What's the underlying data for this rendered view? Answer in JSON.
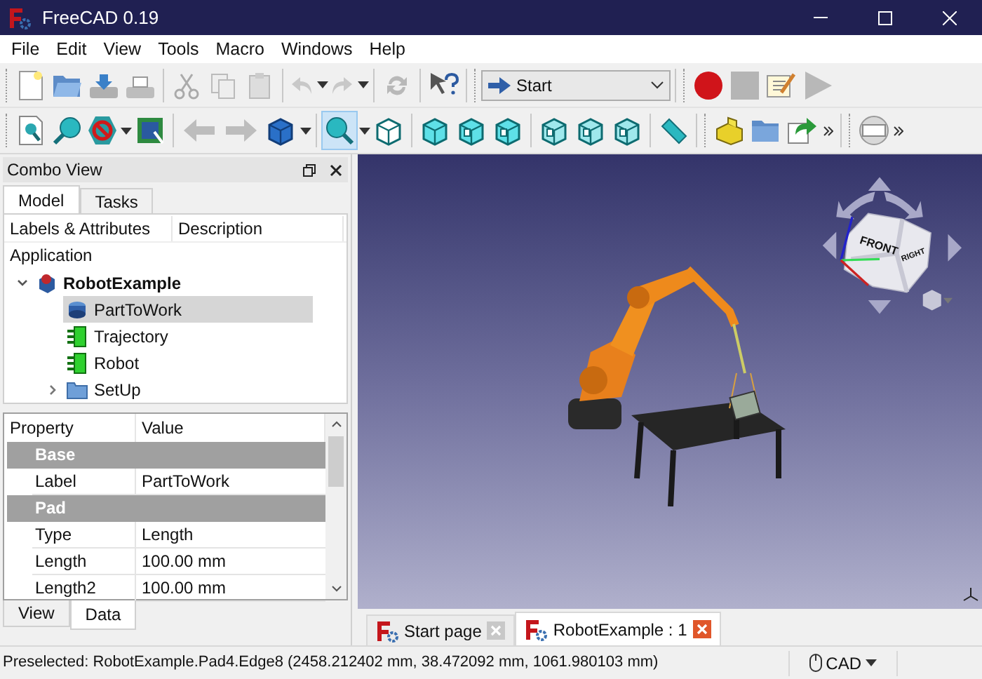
{
  "window": {
    "title": "FreeCAD 0.19"
  },
  "menu": [
    "File",
    "Edit",
    "View",
    "Tools",
    "Macro",
    "Windows",
    "Help"
  ],
  "workbench_selector": {
    "value": "Start"
  },
  "combo_view": {
    "title": "Combo View",
    "tabs": [
      {
        "label": "Model",
        "selected": true
      },
      {
        "label": "Tasks",
        "selected": false
      }
    ],
    "tree": {
      "columns": [
        "Labels & Attributes",
        "Description"
      ],
      "root_label": "Application",
      "items": [
        {
          "label": "RobotExample",
          "kind": "document",
          "expanded": true,
          "selected": false,
          "children": [
            {
              "label": "PartToWork",
              "kind": "part",
              "selected": true
            },
            {
              "label": "Trajectory",
              "kind": "robot-object",
              "selected": false
            },
            {
              "label": "Robot",
              "kind": "robot-object",
              "selected": false
            },
            {
              "label": "SetUp",
              "kind": "folder",
              "expanded": false,
              "selected": false
            }
          ]
        }
      ]
    },
    "properties": {
      "columns": [
        "Property",
        "Value"
      ],
      "rows": [
        {
          "kind": "group",
          "name": "Base"
        },
        {
          "kind": "property",
          "name": "Label",
          "value": "PartToWork"
        },
        {
          "kind": "group",
          "name": "Pad"
        },
        {
          "kind": "property",
          "name": "Type",
          "value": "Length"
        },
        {
          "kind": "property",
          "name": "Length",
          "value": "100.00 mm"
        },
        {
          "kind": "property",
          "name": "Length2",
          "value": "100.00 mm"
        }
      ]
    },
    "bottom_tabs": [
      {
        "label": "View",
        "selected": false
      },
      {
        "label": "Data",
        "selected": true
      }
    ]
  },
  "viewport": {
    "cube_faces": [
      "FRONT",
      "RIGHT"
    ]
  },
  "document_tabs": [
    {
      "label": "Start page",
      "selected": false
    },
    {
      "label": "RobotExample : 1",
      "selected": true
    }
  ],
  "status_bar": {
    "message": "Preselected: RobotExample.Pad4.Edge8 (2458.212402 mm, 38.472092 mm, 1061.980103 mm)",
    "navigation_style": "CAD"
  }
}
